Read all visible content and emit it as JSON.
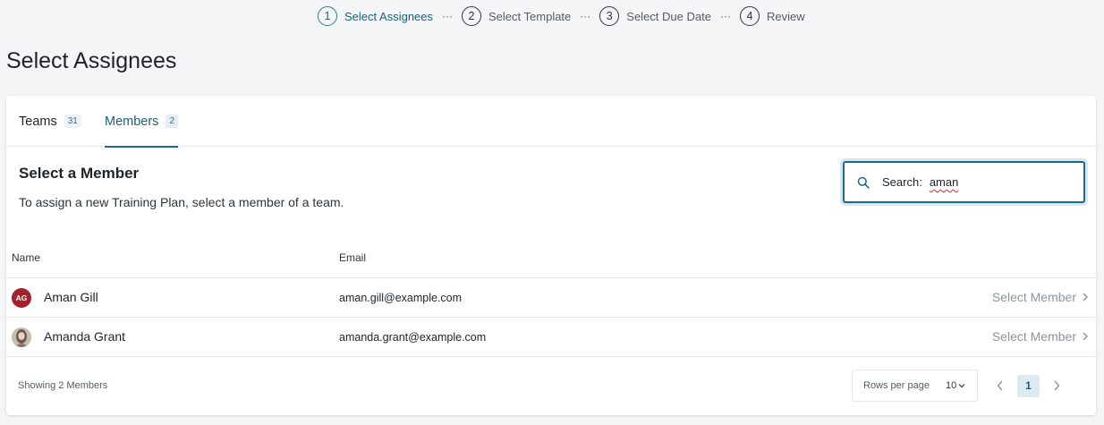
{
  "stepper": {
    "steps": [
      {
        "num": "1",
        "label": "Select Assignees"
      },
      {
        "num": "2",
        "label": "Select Template"
      },
      {
        "num": "3",
        "label": "Select Due Date"
      },
      {
        "num": "4",
        "label": "Review"
      }
    ],
    "separator": "···"
  },
  "page": {
    "title": "Select Assignees"
  },
  "tabs": [
    {
      "label": "Teams",
      "count": "31"
    },
    {
      "label": "Members",
      "count": "2"
    }
  ],
  "section": {
    "title": "Select a Member",
    "description": "To assign a new Training Plan, select a member of a team."
  },
  "search": {
    "label": "Search:",
    "value": "aman",
    "icon": "search-icon"
  },
  "table": {
    "columns": [
      "Name",
      "Email"
    ],
    "rows": [
      {
        "initials": "AG",
        "name": "Aman Gill",
        "email": "aman.gill@example.com",
        "action": "Select Member"
      },
      {
        "initials": "",
        "name": "Amanda Grant",
        "email": "amanda.grant@example.com",
        "action": "Select Member"
      }
    ]
  },
  "footer": {
    "showing": "Showing 2 Members",
    "rows_per_page_label": "Rows per page",
    "rows_per_page_value": "10",
    "current_page": "1"
  },
  "colors": {
    "accent": "#1d6a86",
    "avatar_initials_bg": "#a1232b",
    "muted": "#8d949b"
  }
}
